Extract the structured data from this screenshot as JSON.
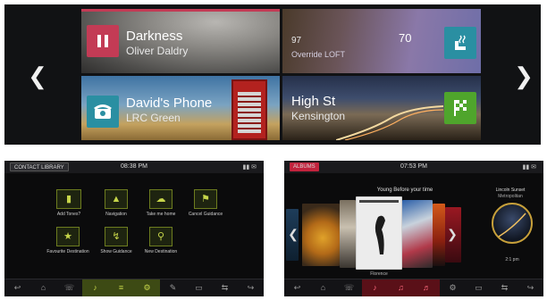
{
  "colors": {
    "music_accent": "#c33b55",
    "phone_accent": "#2a8fa2",
    "nav_accent": "#4fa52c",
    "contacts_accent": "#8ea21f",
    "media_accent": "#c2233d"
  },
  "home": {
    "prev_icon": "chevron-left-icon",
    "next_icon": "chevron-right-icon",
    "music": {
      "title": "Darkness",
      "artist": "Oliver Daldry",
      "button_icon": "pause-icon"
    },
    "climate": {
      "setting": "97",
      "value": "70",
      "subtitle": "Override LOFT",
      "button_icon": "seat-heat-icon"
    },
    "phone": {
      "title": "David's Phone",
      "subtitle": "LRC Green",
      "button_icon": "phone-icon"
    },
    "navigation": {
      "title": "High St",
      "subtitle": "Kensington",
      "button_icon": "checkered-flag-icon"
    }
  },
  "contacts_screen": {
    "header_label": "CONTACT LIBRARY",
    "clock": "08:38 PM",
    "tiles": [
      {
        "icon": "tag-icon",
        "label": "Add Tones?"
      },
      {
        "icon": "navigation-icon",
        "label": "Navigation"
      },
      {
        "icon": "chat-icon",
        "label": "Take me home"
      },
      {
        "icon": "flag-icon",
        "label": "Cancel Guidance"
      },
      {
        "icon": "favourite-icon",
        "label": "Favourite Destination"
      },
      {
        "icon": "route-icon",
        "label": "Show Guidance"
      },
      {
        "icon": "search-icon",
        "label": "New Destination"
      }
    ],
    "dock": [
      "↩",
      "⌂",
      "☏",
      "♪",
      "≡",
      "⚙",
      "✎",
      "▭",
      "⇆",
      "↪"
    ]
  },
  "media_screen": {
    "header_label": "ALBUMS",
    "clock": "07:53 PM",
    "now_playing_title": "Young Before your time",
    "now_playing_artist": "Florence",
    "side_title": "Lincoln Sunset",
    "side_subtitle": "Metropolitan",
    "side_time": "2:1 pm",
    "prev_icon": "chevron-left-icon",
    "next_icon": "chevron-right-icon",
    "dock": [
      "↩",
      "⌂",
      "☏",
      "♪",
      "♫",
      "♬",
      "⚙",
      "▭",
      "⇆",
      "↪"
    ]
  }
}
